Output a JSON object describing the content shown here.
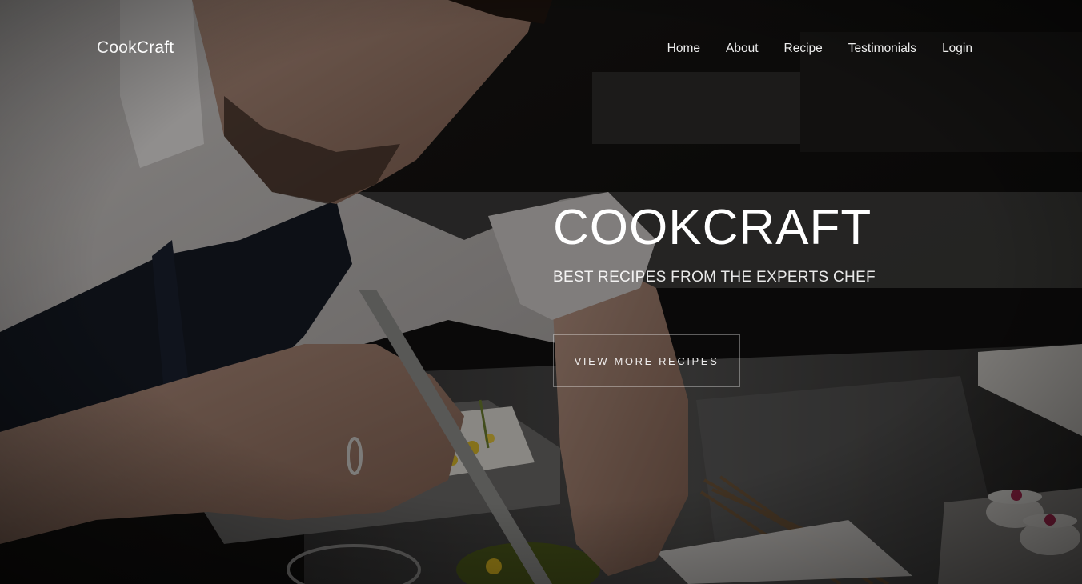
{
  "nav": {
    "brand_light": "Cook",
    "brand_bold": "Craft",
    "items": [
      {
        "label": "Home"
      },
      {
        "label": "About"
      },
      {
        "label": "Recipe"
      },
      {
        "label": "Testimonials"
      },
      {
        "label": "Login"
      }
    ]
  },
  "hero": {
    "title": "COOKCRAFT",
    "subtitle": "BEST RECIPES FROM THE EXPERTS CHEF",
    "cta_label": "VIEW MORE RECIPES",
    "background_image": "chef-plating-food-photo"
  },
  "colors": {
    "overlay": "#000000",
    "text": "#ffffff",
    "button_border": "#8a8a8a"
  }
}
